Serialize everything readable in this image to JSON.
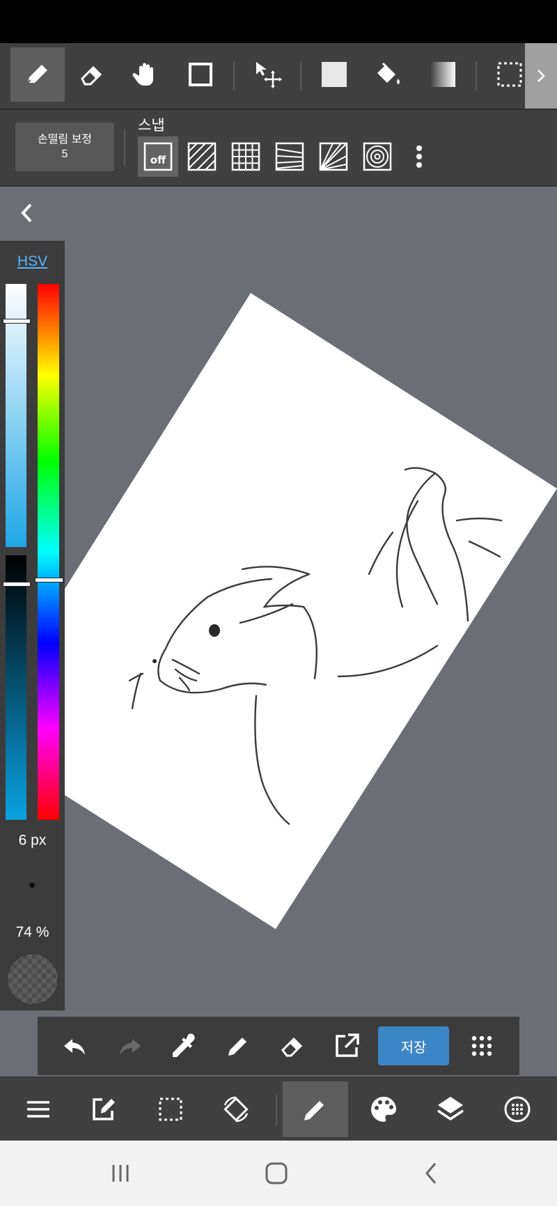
{
  "colors": {
    "toolbar_bg": "#404040",
    "active_tool_bg": "#5e5e5e",
    "canvas_bg": "#6b6e74",
    "save_button": "#3d86c6",
    "hsv_link": "#59b4ff"
  },
  "toolbar": {
    "tools": [
      "pen-icon",
      "eraser-icon",
      "hand-icon",
      "rectangle-icon",
      "move-icon",
      "fill-square-icon",
      "bucket-icon",
      "gradient-icon",
      "selection-icon"
    ],
    "active_tool": "pen-icon",
    "next_icon": "chevron-right-icon"
  },
  "subbar": {
    "stabilizer_label": "손떨림 보정",
    "stabilizer_value": "5",
    "snap_label": "스냅",
    "snap_off_label": "off",
    "snap_modes": [
      "off",
      "parallel-lines",
      "grid",
      "perspective",
      "radial",
      "concentric"
    ],
    "more_icon": "more-vertical-icon"
  },
  "color_panel": {
    "mode_label": "HSV",
    "brush_size": "6 px",
    "opacity": "74 %",
    "hue_level": 0.5,
    "saturation_level": 0.13,
    "brightness_level": 0.1
  },
  "bottom_tools": {
    "save_label": "저장",
    "icons": [
      "undo-icon",
      "redo-icon",
      "eyedropper-icon",
      "pen-icon",
      "eraser-icon",
      "export-icon",
      "grid-menu-icon"
    ]
  },
  "main_bar": {
    "icons": [
      "menu-icon",
      "edit-icon",
      "select-icon",
      "rotate-icon",
      "brush-icon",
      "palette-icon",
      "layers-icon",
      "material-icon"
    ],
    "active": "brush-icon"
  },
  "system_nav": {
    "icons": [
      "recents-icon",
      "home-icon",
      "back-icon"
    ]
  }
}
